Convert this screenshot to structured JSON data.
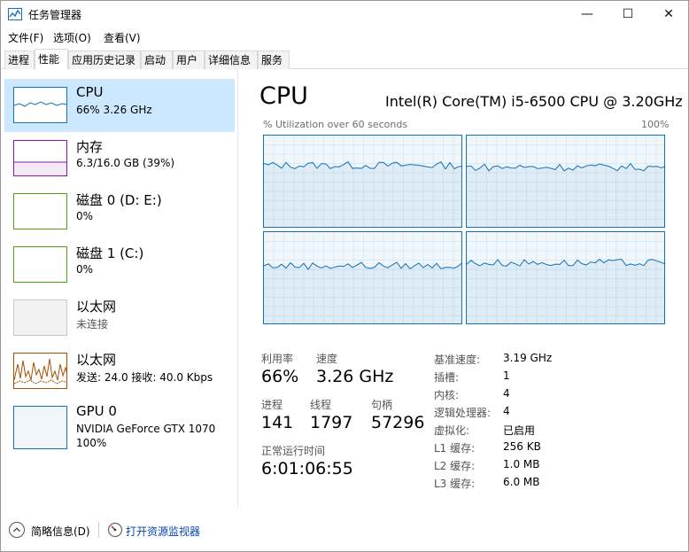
{
  "window": {
    "title": "任务管理器",
    "minimize_glyph": "—",
    "maximize_glyph": "☐",
    "close_glyph": "✕"
  },
  "menu": [
    "文件(F)",
    "选项(O)",
    "查看(V)"
  ],
  "tabs": [
    "进程",
    "性能",
    "应用历史记录",
    "启动",
    "用户",
    "详细信息",
    "服务"
  ],
  "active_tab": "性能",
  "sidebar": {
    "items": [
      {
        "name": "CPU",
        "line1": "66% 3.26 GHz",
        "line2": "",
        "color": "#1172ba"
      },
      {
        "name": "内存",
        "line1": "6.3/16.0 GB (39%)",
        "line2": "",
        "color": "#8b12ae"
      },
      {
        "name": "磁盘 0 (D: E:)",
        "line1": "0%",
        "line2": "",
        "color": "#4da60c"
      },
      {
        "name": "磁盘 1 (C:)",
        "line1": "0%",
        "line2": "",
        "color": "#4da60c"
      },
      {
        "name": "以太网",
        "line1": "未连接",
        "line2": "",
        "color": "#bdbdbd"
      },
      {
        "name": "以太网",
        "line1": "发送: 24.0  接收: 40.0 Kbps",
        "line2": "",
        "color": "#a74f01"
      },
      {
        "name": "GPU 0",
        "line1": "NVIDIA GeForce GTX 1070",
        "line2": "100%",
        "color": "#1172ba"
      }
    ]
  },
  "detail": {
    "title": "CPU",
    "model": "Intel(R) Core(TM) i5-6500 CPU @ 3.20GHz",
    "graph_label": "% Utilization over 60 seconds",
    "graph_max": "100%",
    "stats": {
      "utilization_label": "利用率",
      "utilization": "66%",
      "speed_label": "速度",
      "speed": "3.26 GHz",
      "processes_label": "进程",
      "processes": "141",
      "threads_label": "线程",
      "threads": "1797",
      "handles_label": "句柄",
      "handles": "57296",
      "uptime_label": "正常运行时间",
      "uptime": "6:01:06:55"
    },
    "specs": [
      {
        "label": "基准速度:",
        "value": "3.19 GHz"
      },
      {
        "label": "插槽:",
        "value": "1"
      },
      {
        "label": "内核:",
        "value": "4"
      },
      {
        "label": "逻辑处理器:",
        "value": "4"
      },
      {
        "label": "虚拟化:",
        "value": "已启用"
      },
      {
        "label": "L1 缓存:",
        "value": "256 KB"
      },
      {
        "label": "L2 缓存:",
        "value": "1.0 MB"
      },
      {
        "label": "L3 缓存:",
        "value": "6.0 MB"
      }
    ],
    "core_graph_levels": [
      0.68,
      0.66,
      0.64,
      0.67
    ]
  },
  "footer": {
    "fewer_details": "简略信息(D)",
    "open_monitor": "打开资源监视器"
  },
  "colors": {
    "accent": "#1172ba",
    "selected_bg": "#cce8ff",
    "graph_bg": "#f1f6fa",
    "grid": "#d9eaf7"
  }
}
